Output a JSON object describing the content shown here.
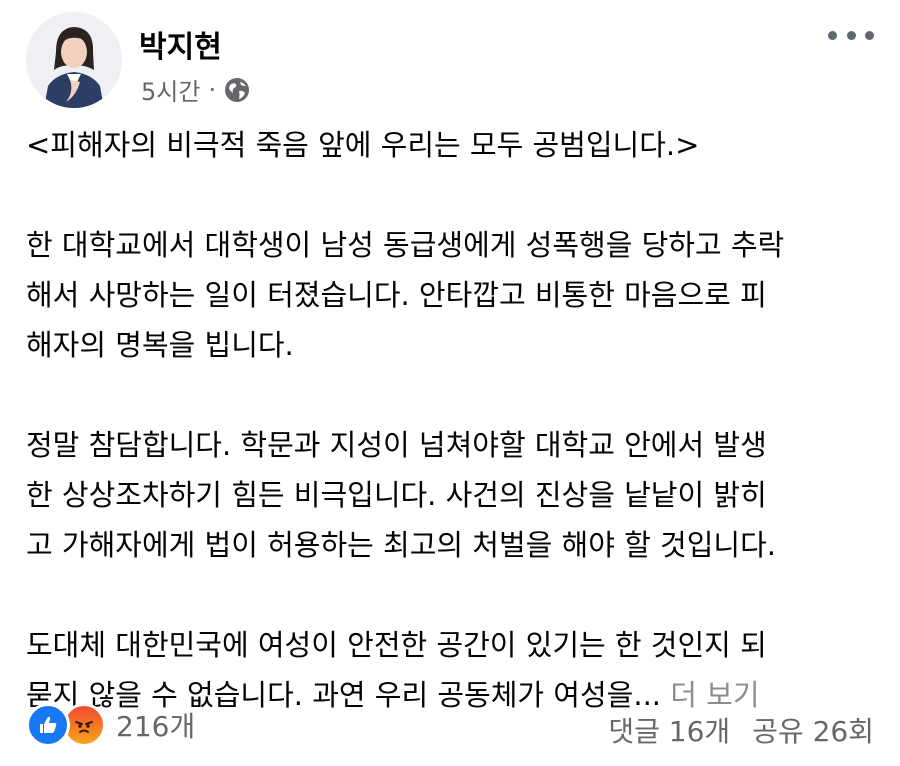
{
  "post": {
    "author": "박지현",
    "time": "5시간",
    "separator": "·",
    "privacy_icon": "globe-icon",
    "more_icon": "more-horizontal-icon",
    "paragraphs": [
      [
        "<피해자의 비극적 죽음 앞에 우리는 모두 공범입니다.>"
      ],
      [
        "한 대학교에서 대학생이 남성 동급생에게 성폭행을 당하고 추락",
        "해서 사망하는 일이 터졌습니다. 안타깝고 비통한 마음으로 피",
        "해자의 명복을 빕니다."
      ],
      [
        "정말 참담합니다. 학문과 지성이 넘쳐야할 대학교 안에서 발생",
        "한 상상조차하기 힘든 비극입니다. 사건의 진상을 낱낱이 밝히",
        "고 가해자에게 법이 허용하는 최고의 처벌을 해야 할 것입니다."
      ],
      [
        "도대체 대한민국에 여성이 안전한 공간이 있기는 한 것인지 되",
        "묻지 않을 수 없습니다. 과연 우리 공동체가 여성을..."
      ]
    ],
    "see_more": "더 보기"
  },
  "footer": {
    "reaction_icons": [
      "like-icon",
      "angry-icon"
    ],
    "reaction_count": "216개",
    "comments": "댓글 16개",
    "shares": "공유 26회"
  },
  "colors": {
    "text": "#050505",
    "muted": "#65676b",
    "like_blue": "#1877f2",
    "angry_orange": "#f04b2e"
  }
}
